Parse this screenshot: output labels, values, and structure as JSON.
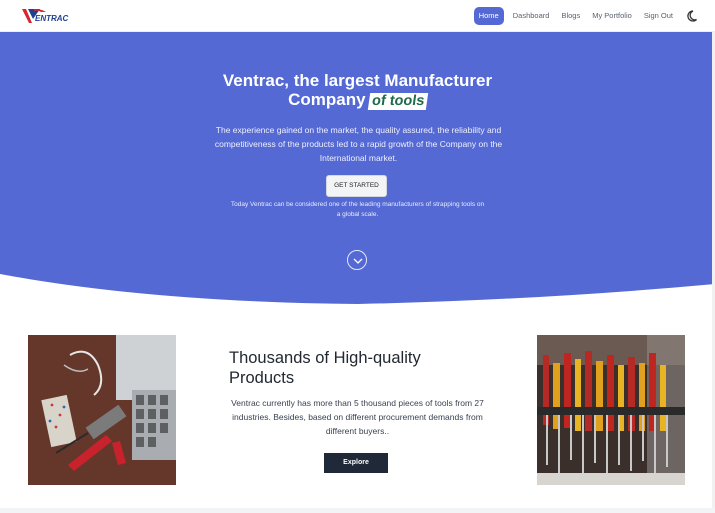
{
  "brand": {
    "logo_text": "VENTRAC"
  },
  "nav": {
    "items": [
      "Home",
      "Dashboard",
      "Blogs",
      "My Portfolio",
      "Sign Out"
    ],
    "theme_toggle_icon": "moon-icon"
  },
  "hero": {
    "title_line1": "Ventrac, the largest Manufacturer",
    "title_line2": "Company",
    "title_highlight": "of tools",
    "description": "The experience gained on the market, the quality assured, the reliability and competitiveness of the products led to a rapid growth of the Company on the International market.",
    "cta_label": "GET STARTED",
    "note": "Today Ventrac can be considered one of the leading manufacturers of strapping tools on a global scale.",
    "scroll_icon": "chevron-down-icon",
    "colors": {
      "background": "#5469d4",
      "highlight_text": "#1f6a4a"
    }
  },
  "feature": {
    "title": "Thousands of High-quality Products",
    "description": "Ventrac currently has more than 5 thousand pieces of tools from 27 industries. Besides, based on different procurement demands from different buyers..",
    "button_label": "Explore"
  }
}
